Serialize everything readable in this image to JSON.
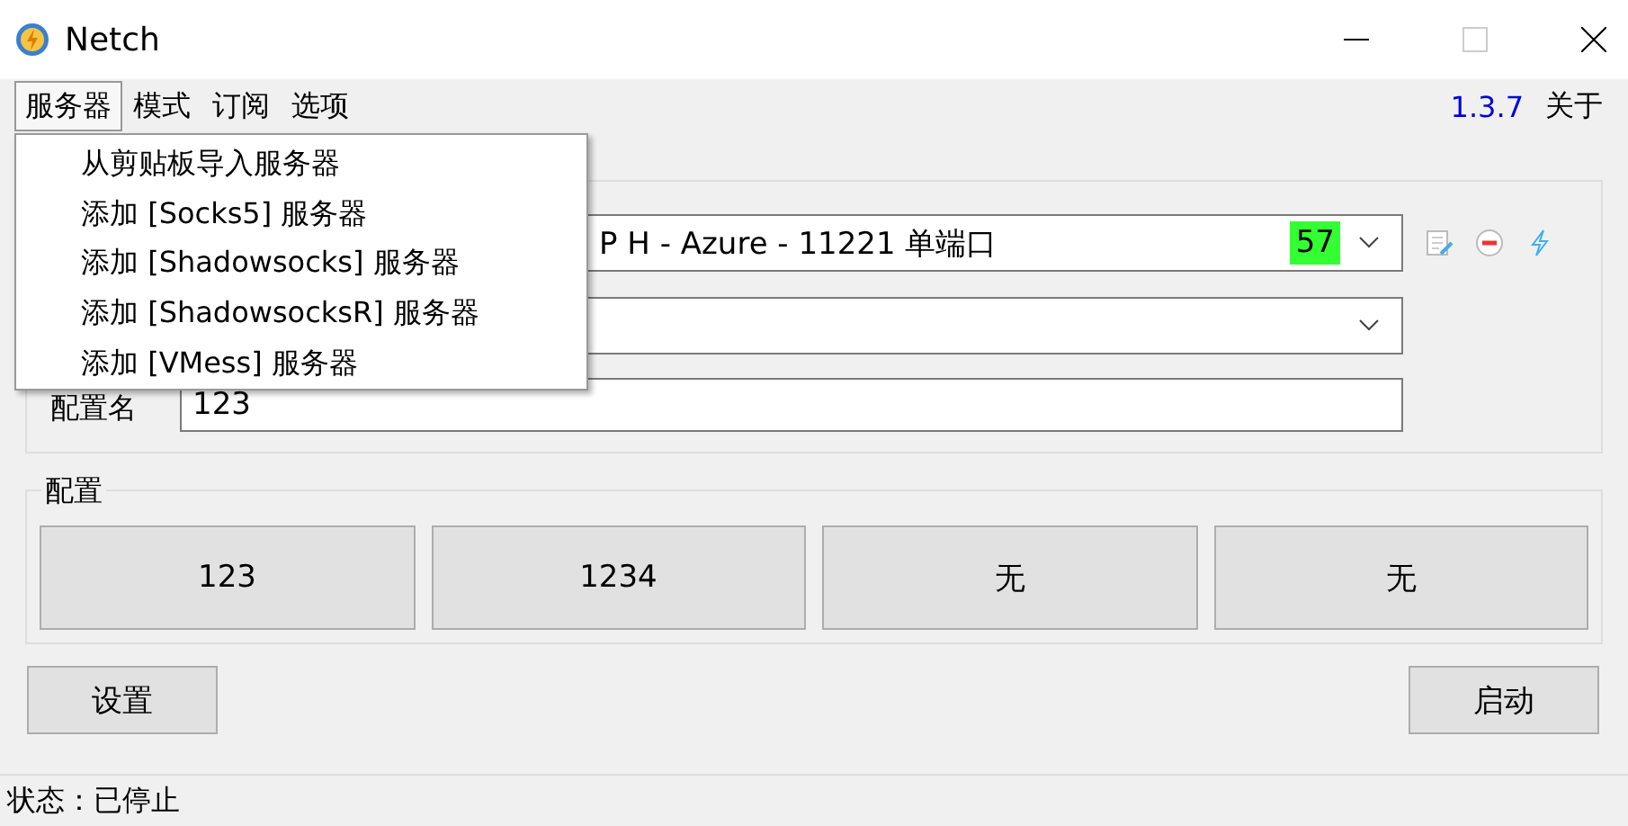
{
  "window": {
    "title": "Netch"
  },
  "menu_bar": {
    "items": [
      {
        "label": "服务器",
        "selected": true
      },
      {
        "label": "模式",
        "selected": false
      },
      {
        "label": "订阅",
        "selected": false
      },
      {
        "label": "选项",
        "selected": false
      }
    ],
    "version": "1.3.7",
    "about": "关于"
  },
  "dropdown": {
    "items": [
      "从剪贴板导入服务器",
      "添加 [Socks5] 服务器",
      "添加 [Shadowsocks] 服务器",
      "添加 [ShadowsocksR] 服务器",
      "添加 [VMess] 服务器"
    ]
  },
  "server": {
    "value": "P H - Azure - 11221 单端口",
    "latency": "57"
  },
  "profile_name": {
    "label": "配置名",
    "value": "123"
  },
  "profiles": {
    "title": "配置",
    "buttons": [
      "123",
      "1234",
      "无",
      "无"
    ]
  },
  "buttons": {
    "settings": "设置",
    "start": "启动"
  },
  "status_bar": {
    "text": "状态：已停止"
  }
}
